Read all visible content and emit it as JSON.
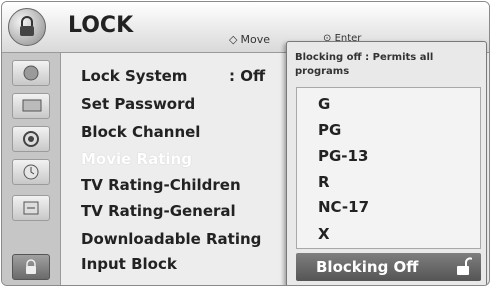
{
  "header": {
    "title": "LOCK",
    "move_hint": "Move",
    "enter_hint": "Enter",
    "icon": "lock-icon"
  },
  "sidebar": {
    "icons": [
      "picture-icon",
      "screen-icon",
      "audio-icon",
      "clock-icon",
      "option-icon",
      "lock-icon"
    ],
    "active_index": 5
  },
  "menu": {
    "items": [
      {
        "label": "Lock System",
        "value": ": Off"
      },
      {
        "label": "Set Password"
      },
      {
        "label": "Block Channel"
      },
      {
        "label": "Movie Rating",
        "selected": true
      },
      {
        "label": "TV Rating-Children"
      },
      {
        "label": "TV Rating-General"
      },
      {
        "label": "Downloadable Rating"
      },
      {
        "label": "Input Block"
      }
    ]
  },
  "popup": {
    "description": "Blocking off : Permits all programs",
    "options": [
      "G",
      "PG",
      "PG-13",
      "R",
      "NC-17",
      "X"
    ],
    "selected": "Blocking Off",
    "selected_icon": "unlocked-padlock-icon"
  },
  "colors": {
    "selected_bar": "#555555",
    "selected_text": "#ffffff"
  }
}
